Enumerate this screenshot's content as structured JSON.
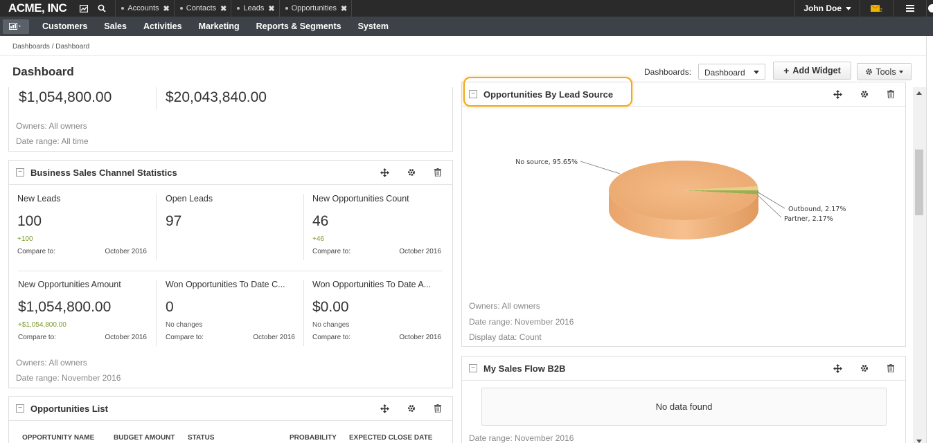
{
  "app": {
    "logo": "ACME, INC"
  },
  "topbar": {
    "tabs": [
      {
        "label": "Accounts"
      },
      {
        "label": "Contacts"
      },
      {
        "label": "Leads"
      },
      {
        "label": "Opportunities"
      }
    ],
    "user": "John Doe",
    "mail_count": "2",
    "icons": [
      "dashboard-icon",
      "search-icon",
      "mail-icon",
      "menu-icon"
    ],
    "colors": {
      "bar": "#2a2a2a",
      "mail": "#f0b400"
    }
  },
  "nav": {
    "items": [
      "Customers",
      "Sales",
      "Activities",
      "Marketing",
      "Reports & Segments",
      "System"
    ]
  },
  "header": {
    "breadcrumb": "Dashboards / Dashboard",
    "title": "Dashboard",
    "dashboards_label": "Dashboards:",
    "dashboard_select": "Dashboard",
    "add_widget": "Add Widget",
    "tools": "Tools"
  },
  "top_widget": {
    "value1": "$1,054,800.00",
    "value2": "$20,043,840.00",
    "owners": "Owners: All owners",
    "date_range": "Date range: All time"
  },
  "bsc_widget": {
    "title": "Business Sales Channel Statistics",
    "metrics": [
      {
        "label": "New Leads",
        "value": "100",
        "change": "+100",
        "compare_label": "Compare to:",
        "compare_value": "October 2016"
      },
      {
        "label": "Open Leads",
        "value": "97",
        "change": "",
        "compare_label": "",
        "compare_value": ""
      },
      {
        "label": "New Opportunities Count",
        "value": "46",
        "change": "+46",
        "compare_label": "Compare to:",
        "compare_value": "October 2016"
      },
      {
        "label": "New Opportunities Amount",
        "value": "$1,054,800.00",
        "change": "+$1,054,800.00",
        "compare_label": "Compare to:",
        "compare_value": "October 2016"
      },
      {
        "label": "Won Opportunities To Date C...",
        "value": "0",
        "change": "No changes",
        "compare_label": "Compare to:",
        "compare_value": "October 2016"
      },
      {
        "label": "Won Opportunities To Date A...",
        "value": "$0.00",
        "change": "No changes",
        "compare_label": "Compare to:",
        "compare_value": "October 2016"
      }
    ],
    "owners": "Owners: All owners",
    "date_range": "Date range: November 2016"
  },
  "opp_list": {
    "title": "Opportunities List",
    "columns": [
      "OPPORTUNITY NAME",
      "BUDGET AMOUNT",
      "STATUS",
      "PROBABILITY",
      "EXPECTED CLOSE DATE"
    ]
  },
  "lead_source_widget": {
    "title": "Opportunities By Lead Source",
    "owners": "Owners: All owners",
    "date_range": "Date range: November 2016",
    "display_data": "Display data: Count",
    "labels": {
      "no_source": "No source, 95.65%",
      "outbound": "Outbound, 2.17%",
      "partner": "Partner, 2.17%"
    }
  },
  "sales_flow_widget": {
    "title": "My Sales Flow B2B",
    "empty": "No data found",
    "date_range": "Date range: November 2016"
  },
  "chart_data": {
    "type": "pie",
    "categories": [
      "No source",
      "Outbound",
      "Partner"
    ],
    "values": [
      95.65,
      2.17,
      2.17
    ],
    "colors": [
      "#f0b47c",
      "#e6d08a",
      "#9bb050"
    ]
  }
}
